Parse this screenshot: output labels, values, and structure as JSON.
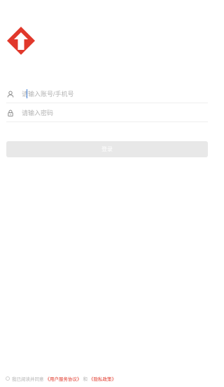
{
  "brand": {
    "logo_icon": "red-up-arrow-diamond-logo",
    "accent_color": "#e1382b"
  },
  "login_form": {
    "account": {
      "icon": "user-icon",
      "placeholder": "请输入账号/手机号",
      "value": ""
    },
    "password": {
      "icon": "lock-icon",
      "placeholder": "请输入密码",
      "value": ""
    },
    "submit_label": "登录"
  },
  "agreement": {
    "prefix": "我已阅读并同意",
    "user_agreement": "《用户服务协议》",
    "connector": "和",
    "privacy_policy": "《隐私政策》",
    "checked": false
  }
}
